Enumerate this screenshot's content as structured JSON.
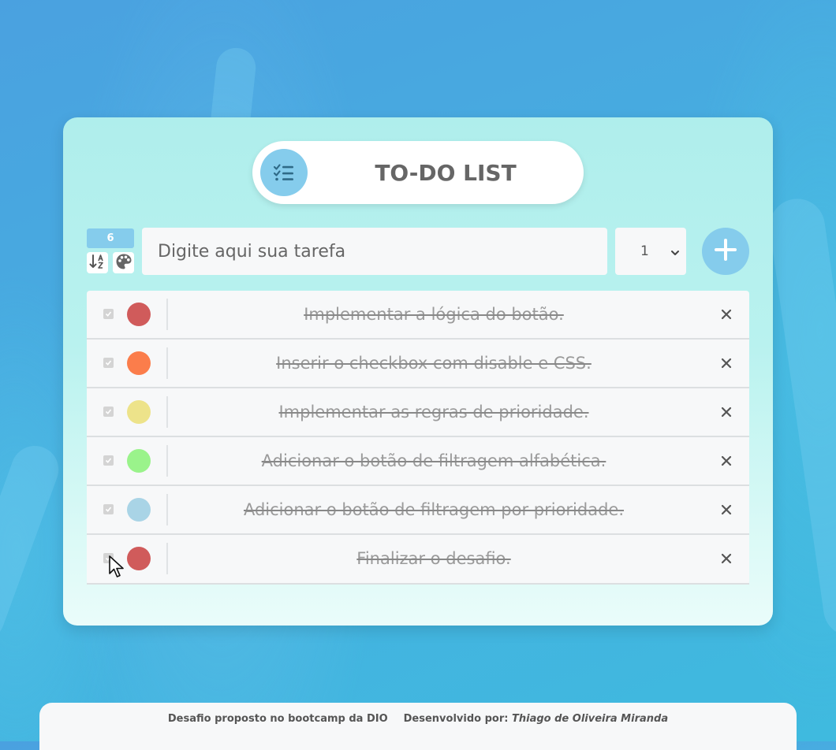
{
  "header": {
    "title": "TO-DO LIST",
    "icon": "checklist-icon"
  },
  "toolbar": {
    "task_count": "6",
    "sort_icon": "sort-alpha-icon",
    "palette_icon": "palette-icon",
    "input_placeholder": "Digite aqui sua tarefa",
    "input_value": "",
    "priority_selected": "1",
    "add_icon": "plus-icon"
  },
  "tasks": [
    {
      "text": "Implementar a lógica do botão.",
      "done": true,
      "color": "#d05b5b"
    },
    {
      "text": "Inserir o checkbox com disable e CSS.",
      "done": true,
      "color": "#fb7d4b"
    },
    {
      "text": "Implementar as regras de prioridade.",
      "done": true,
      "color": "#ede38a"
    },
    {
      "text": "Adicionar o botão de filtragem alfabética.",
      "done": true,
      "color": "#9af38b"
    },
    {
      "text": "Adicionar o botão de filtragem por prioridade.",
      "done": true,
      "color": "#a9d4e6"
    },
    {
      "text": "Finalizar o desafio.",
      "done": true,
      "color": "#d05b5b"
    }
  ],
  "footer": {
    "left_text": "Desafio proposto no bootcamp da DIO",
    "right_label": "Desenvolvido por:",
    "author": "Thiago de Oliveira Miranda"
  }
}
